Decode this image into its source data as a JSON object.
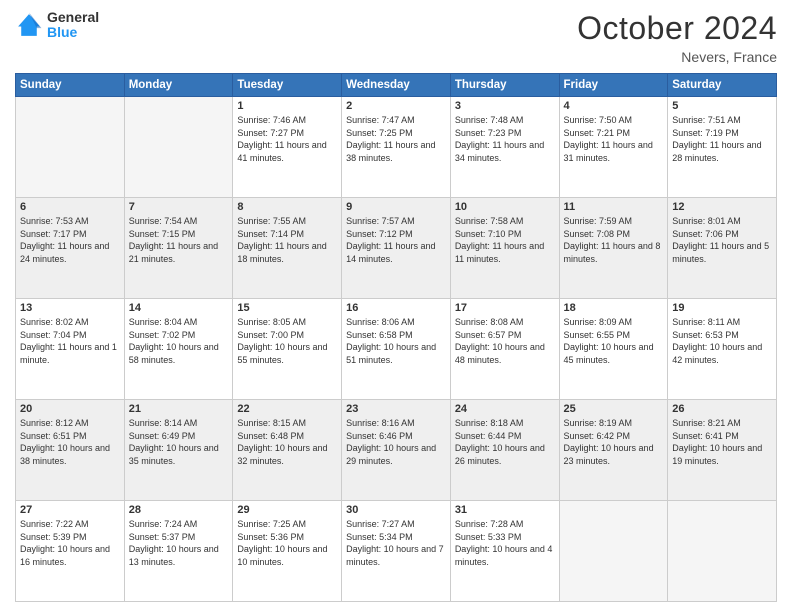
{
  "header": {
    "logo_line1": "General",
    "logo_line2": "Blue",
    "month_title": "October 2024",
    "location": "Nevers, France"
  },
  "days_of_week": [
    "Sunday",
    "Monday",
    "Tuesday",
    "Wednesday",
    "Thursday",
    "Friday",
    "Saturday"
  ],
  "weeks": [
    [
      {
        "day": "",
        "sunrise": "",
        "sunset": "",
        "daylight": ""
      },
      {
        "day": "",
        "sunrise": "",
        "sunset": "",
        "daylight": ""
      },
      {
        "day": "1",
        "sunrise": "Sunrise: 7:46 AM",
        "sunset": "Sunset: 7:27 PM",
        "daylight": "Daylight: 11 hours and 41 minutes."
      },
      {
        "day": "2",
        "sunrise": "Sunrise: 7:47 AM",
        "sunset": "Sunset: 7:25 PM",
        "daylight": "Daylight: 11 hours and 38 minutes."
      },
      {
        "day": "3",
        "sunrise": "Sunrise: 7:48 AM",
        "sunset": "Sunset: 7:23 PM",
        "daylight": "Daylight: 11 hours and 34 minutes."
      },
      {
        "day": "4",
        "sunrise": "Sunrise: 7:50 AM",
        "sunset": "Sunset: 7:21 PM",
        "daylight": "Daylight: 11 hours and 31 minutes."
      },
      {
        "day": "5",
        "sunrise": "Sunrise: 7:51 AM",
        "sunset": "Sunset: 7:19 PM",
        "daylight": "Daylight: 11 hours and 28 minutes."
      }
    ],
    [
      {
        "day": "6",
        "sunrise": "Sunrise: 7:53 AM",
        "sunset": "Sunset: 7:17 PM",
        "daylight": "Daylight: 11 hours and 24 minutes."
      },
      {
        "day": "7",
        "sunrise": "Sunrise: 7:54 AM",
        "sunset": "Sunset: 7:15 PM",
        "daylight": "Daylight: 11 hours and 21 minutes."
      },
      {
        "day": "8",
        "sunrise": "Sunrise: 7:55 AM",
        "sunset": "Sunset: 7:14 PM",
        "daylight": "Daylight: 11 hours and 18 minutes."
      },
      {
        "day": "9",
        "sunrise": "Sunrise: 7:57 AM",
        "sunset": "Sunset: 7:12 PM",
        "daylight": "Daylight: 11 hours and 14 minutes."
      },
      {
        "day": "10",
        "sunrise": "Sunrise: 7:58 AM",
        "sunset": "Sunset: 7:10 PM",
        "daylight": "Daylight: 11 hours and 11 minutes."
      },
      {
        "day": "11",
        "sunrise": "Sunrise: 7:59 AM",
        "sunset": "Sunset: 7:08 PM",
        "daylight": "Daylight: 11 hours and 8 minutes."
      },
      {
        "day": "12",
        "sunrise": "Sunrise: 8:01 AM",
        "sunset": "Sunset: 7:06 PM",
        "daylight": "Daylight: 11 hours and 5 minutes."
      }
    ],
    [
      {
        "day": "13",
        "sunrise": "Sunrise: 8:02 AM",
        "sunset": "Sunset: 7:04 PM",
        "daylight": "Daylight: 11 hours and 1 minute."
      },
      {
        "day": "14",
        "sunrise": "Sunrise: 8:04 AM",
        "sunset": "Sunset: 7:02 PM",
        "daylight": "Daylight: 10 hours and 58 minutes."
      },
      {
        "day": "15",
        "sunrise": "Sunrise: 8:05 AM",
        "sunset": "Sunset: 7:00 PM",
        "daylight": "Daylight: 10 hours and 55 minutes."
      },
      {
        "day": "16",
        "sunrise": "Sunrise: 8:06 AM",
        "sunset": "Sunset: 6:58 PM",
        "daylight": "Daylight: 10 hours and 51 minutes."
      },
      {
        "day": "17",
        "sunrise": "Sunrise: 8:08 AM",
        "sunset": "Sunset: 6:57 PM",
        "daylight": "Daylight: 10 hours and 48 minutes."
      },
      {
        "day": "18",
        "sunrise": "Sunrise: 8:09 AM",
        "sunset": "Sunset: 6:55 PM",
        "daylight": "Daylight: 10 hours and 45 minutes."
      },
      {
        "day": "19",
        "sunrise": "Sunrise: 8:11 AM",
        "sunset": "Sunset: 6:53 PM",
        "daylight": "Daylight: 10 hours and 42 minutes."
      }
    ],
    [
      {
        "day": "20",
        "sunrise": "Sunrise: 8:12 AM",
        "sunset": "Sunset: 6:51 PM",
        "daylight": "Daylight: 10 hours and 38 minutes."
      },
      {
        "day": "21",
        "sunrise": "Sunrise: 8:14 AM",
        "sunset": "Sunset: 6:49 PM",
        "daylight": "Daylight: 10 hours and 35 minutes."
      },
      {
        "day": "22",
        "sunrise": "Sunrise: 8:15 AM",
        "sunset": "Sunset: 6:48 PM",
        "daylight": "Daylight: 10 hours and 32 minutes."
      },
      {
        "day": "23",
        "sunrise": "Sunrise: 8:16 AM",
        "sunset": "Sunset: 6:46 PM",
        "daylight": "Daylight: 10 hours and 29 minutes."
      },
      {
        "day": "24",
        "sunrise": "Sunrise: 8:18 AM",
        "sunset": "Sunset: 6:44 PM",
        "daylight": "Daylight: 10 hours and 26 minutes."
      },
      {
        "day": "25",
        "sunrise": "Sunrise: 8:19 AM",
        "sunset": "Sunset: 6:42 PM",
        "daylight": "Daylight: 10 hours and 23 minutes."
      },
      {
        "day": "26",
        "sunrise": "Sunrise: 8:21 AM",
        "sunset": "Sunset: 6:41 PM",
        "daylight": "Daylight: 10 hours and 19 minutes."
      }
    ],
    [
      {
        "day": "27",
        "sunrise": "Sunrise: 7:22 AM",
        "sunset": "Sunset: 5:39 PM",
        "daylight": "Daylight: 10 hours and 16 minutes."
      },
      {
        "day": "28",
        "sunrise": "Sunrise: 7:24 AM",
        "sunset": "Sunset: 5:37 PM",
        "daylight": "Daylight: 10 hours and 13 minutes."
      },
      {
        "day": "29",
        "sunrise": "Sunrise: 7:25 AM",
        "sunset": "Sunset: 5:36 PM",
        "daylight": "Daylight: 10 hours and 10 minutes."
      },
      {
        "day": "30",
        "sunrise": "Sunrise: 7:27 AM",
        "sunset": "Sunset: 5:34 PM",
        "daylight": "Daylight: 10 hours and 7 minutes."
      },
      {
        "day": "31",
        "sunrise": "Sunrise: 7:28 AM",
        "sunset": "Sunset: 5:33 PM",
        "daylight": "Daylight: 10 hours and 4 minutes."
      },
      {
        "day": "",
        "sunrise": "",
        "sunset": "",
        "daylight": ""
      },
      {
        "day": "",
        "sunrise": "",
        "sunset": "",
        "daylight": ""
      }
    ]
  ]
}
